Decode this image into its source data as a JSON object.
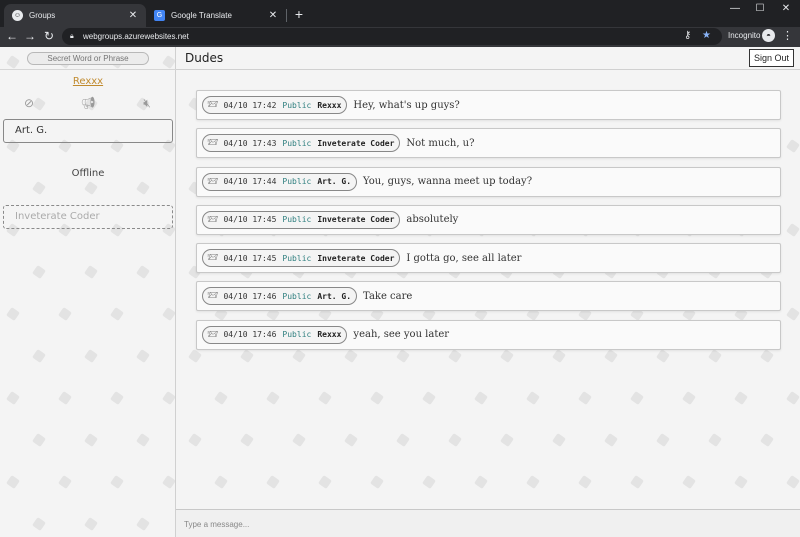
{
  "browser": {
    "tabs": [
      {
        "title": "Groups",
        "favicon": "groups-icon",
        "active": true
      },
      {
        "title": "Google Translate",
        "favicon": "translate-icon",
        "active": false
      }
    ],
    "url": "webgroups.azurewebsites.net",
    "profile_label": "Incognito"
  },
  "sidebar": {
    "search_placeholder": "Secret Word or Phrase",
    "username": "Rexxx",
    "icons": [
      "block-icon",
      "megaphone-icon",
      "mute-icon"
    ],
    "contacts": [
      {
        "name": "Art. G."
      },
      {
        "name": "Inveterate Coder"
      }
    ],
    "status": "Offline"
  },
  "header": {
    "group_name": "Dudes",
    "signout_label": "Sign Out"
  },
  "messages": [
    {
      "time": "04/10 17:42",
      "visibility": "Public",
      "author": "Rexxx",
      "text": "Hey, what's up guys?"
    },
    {
      "time": "04/10 17:43",
      "visibility": "Public",
      "author": "Inveterate Coder",
      "text": "Not much, u?"
    },
    {
      "time": "04/10 17:44",
      "visibility": "Public",
      "author": "Art. G.",
      "text": "You, guys, wanna meet up today?"
    },
    {
      "time": "04/10 17:45",
      "visibility": "Public",
      "author": "Inveterate Coder",
      "text": "absolutely"
    },
    {
      "time": "04/10 17:45",
      "visibility": "Public",
      "author": "Inveterate Coder",
      "text": "I gotta go, see all later"
    },
    {
      "time": "04/10 17:46",
      "visibility": "Public",
      "author": "Art. G.",
      "text": "Take care"
    },
    {
      "time": "04/10 17:46",
      "visibility": "Public",
      "author": "Rexxx",
      "text": "yeah, see you later"
    }
  ],
  "composer": {
    "placeholder": "Type a message...",
    "value": ""
  }
}
